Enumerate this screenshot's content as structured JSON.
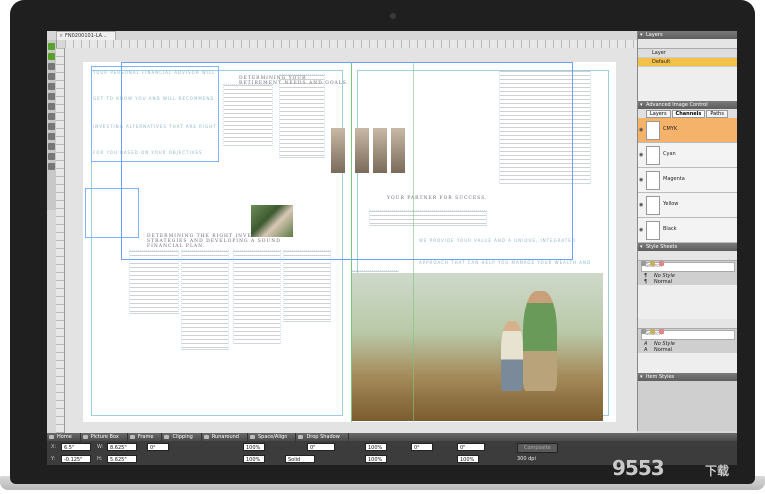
{
  "document": {
    "tab_label": "FN0200101-LA..."
  },
  "page_text": {
    "lines_left": [
      "YOUR PERSONAL FINANCIAL ADVISOR WILL",
      "GET TO KNOW YOU AND WILL RECOMMEND",
      "INVESTING ALTERNATIVES THAT ARE RIGHT",
      "FOR YOU BASED ON YOUR OBJECTIVES"
    ],
    "heading_needs": "DETERMINING YOUR RETIREMENT NEEDS AND GOALS.",
    "heading_plan": "DETERMINING THE RIGHT INVESTING STRATEGIES AND DEVELOPING A SOUND FINANCIAL PLAN.",
    "heading_success": "YOUR PARTNER FOR SUCCESS.",
    "lines_right": [
      "WE PROVIDE YOUR VALUE AND A UNIQUE, INTEGRATED",
      "APPROACH THAT CAN HELP YOU MANAGE YOUR WEALTH AND",
      "ACHIEVE YOUR FINANCIAL GOALS."
    ]
  },
  "layers_panel": {
    "title": "Layers",
    "header_label": "Layer",
    "rows": [
      {
        "label": "Default",
        "selected": true
      }
    ]
  },
  "image_control_panel": {
    "title": "Advanced Image Control",
    "tabs": [
      "Layers",
      "Channels",
      "Paths"
    ],
    "active_tab": "Channels",
    "channels": [
      {
        "label": "CMYK",
        "selected": true
      },
      {
        "label": "Cyan",
        "selected": false
      },
      {
        "label": "Magenta",
        "selected": false
      },
      {
        "label": "Yellow",
        "selected": false
      },
      {
        "label": "Black",
        "selected": false
      }
    ]
  },
  "style_sheets_panel": {
    "title": "Style Sheets",
    "search_placeholder": "Search",
    "paragraph_styles": [
      "No Style",
      "Normal"
    ],
    "character_styles": [
      "No Style",
      "Normal"
    ]
  },
  "item_styles_panel": {
    "title": "Item Styles"
  },
  "measurements": {
    "tabs": [
      "Home",
      "Picture Box",
      "Frame",
      "Clipping",
      "Runaround",
      "Space/Align",
      "Drop Shadow"
    ],
    "x": "6.5\"",
    "y": "-0.125\"",
    "w": "8.625\"",
    "h": "5.625\"",
    "scale": "100%",
    "angle": "0°",
    "stroke_style": "Solid",
    "pct1": "100%",
    "pct2": "100%",
    "pct3": "100%",
    "offset_x": "0\"",
    "offset_y": "0\"",
    "zoom": "100%",
    "blend": "Composite",
    "resolution": "300 dpi"
  },
  "colors": {
    "accent_orange": "#f5b26a",
    "selection_yellow": "#f2c14a",
    "guide_green": "#7bc67b",
    "margin_blue": "#9ecfe0"
  }
}
